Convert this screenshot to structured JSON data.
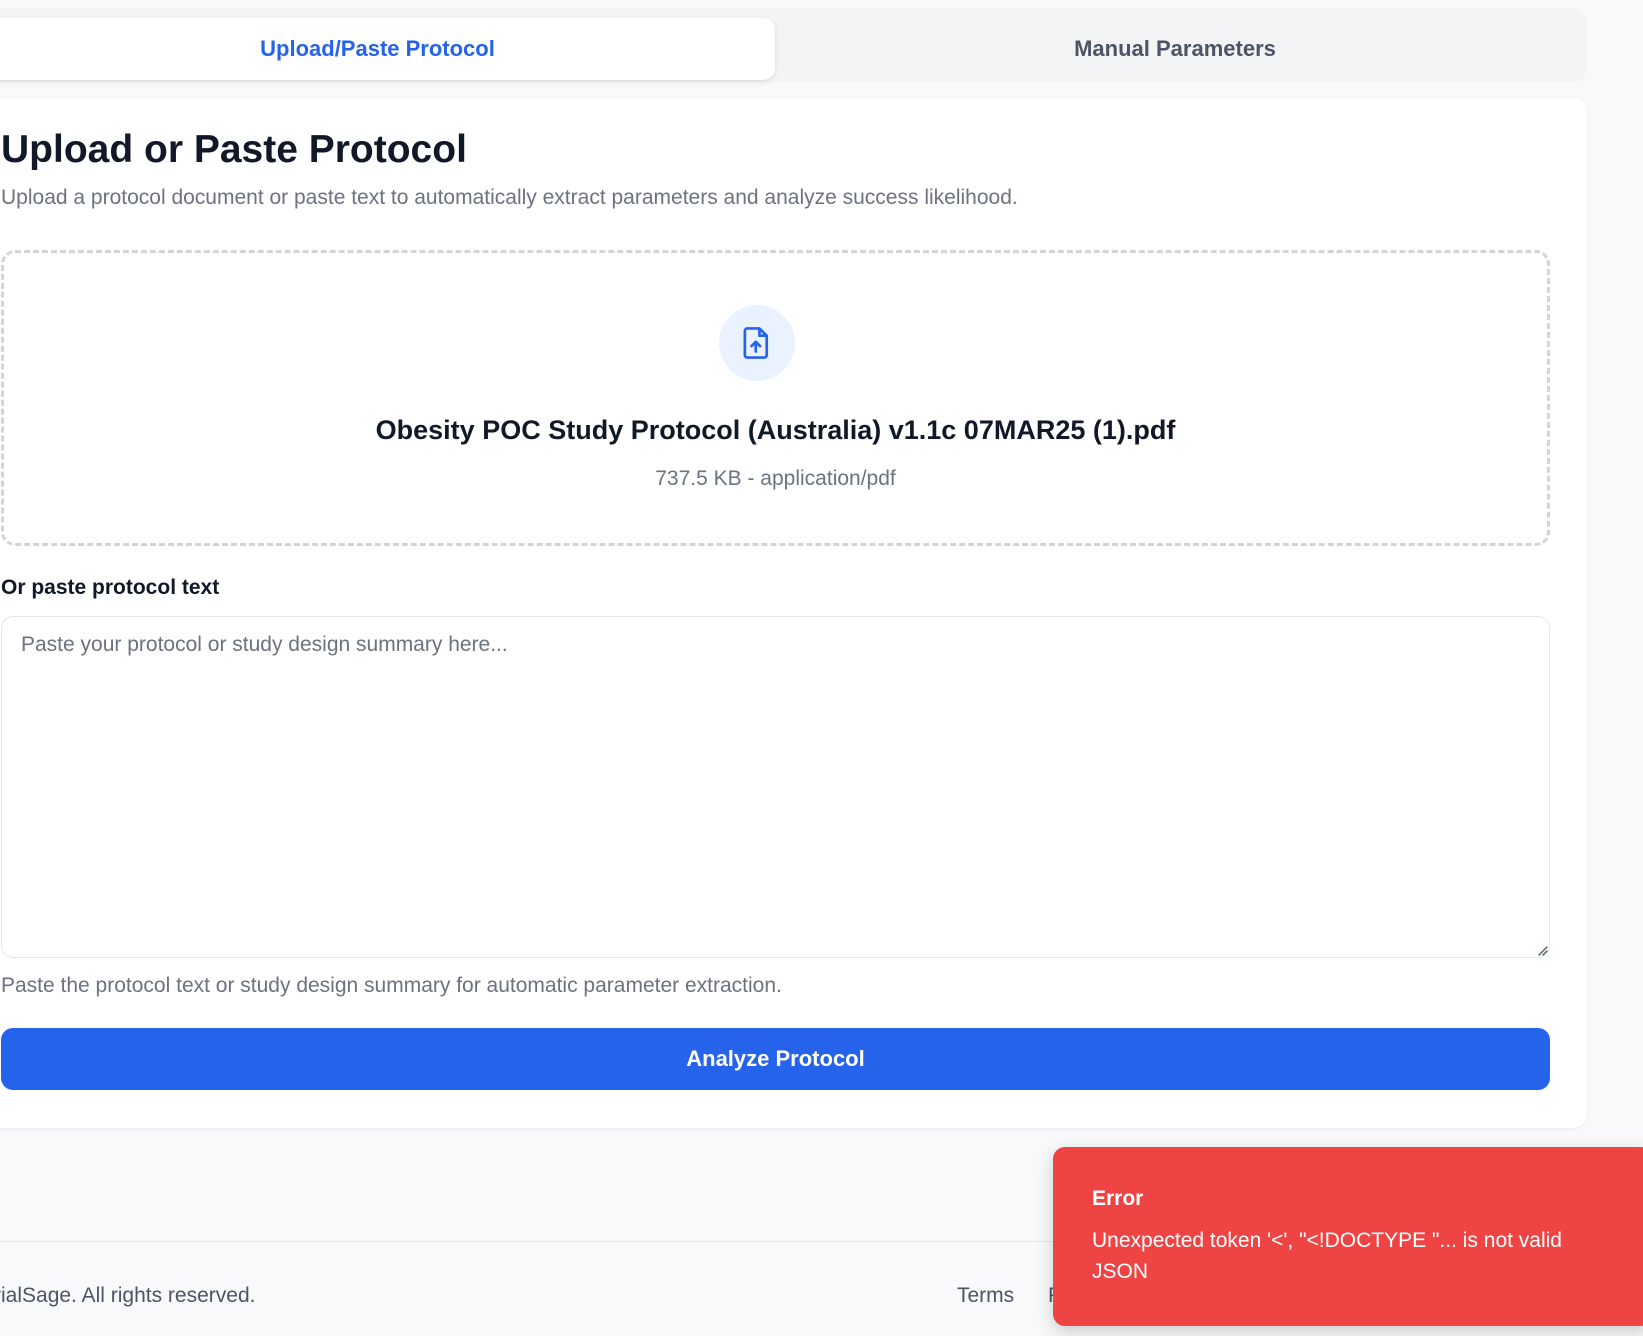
{
  "tabs": {
    "upload_label": "Upload/Paste Protocol",
    "manual_label": "Manual Parameters"
  },
  "main": {
    "title": "Upload or Paste Protocol",
    "subtitle": "Upload a protocol document or paste text to automatically extract parameters and analyze success likelihood."
  },
  "upload": {
    "icon": "file-upload-icon",
    "file_name": "Obesity POC Study Protocol (Australia) v1.1c 07MAR25 (1).pdf",
    "file_meta": "737.5 KB - application/pdf"
  },
  "paste": {
    "label": "Or paste protocol text",
    "placeholder": "Paste your protocol or study design summary here...",
    "value": "",
    "help": "Paste the protocol text or study design summary for automatic parameter extraction."
  },
  "actions": {
    "analyze_label": "Analyze Protocol"
  },
  "footer": {
    "copyright": "rialSage. All rights reserved.",
    "terms_label": "Terms",
    "next_link_fragment": "P"
  },
  "toast": {
    "title": "Error",
    "message": "Unexpected token '<', \"<!DOCTYPE \"... is not valid JSON"
  },
  "colors": {
    "accent": "#2563eb",
    "error": "#ef4444",
    "icon_bg": "#eaf2ff"
  }
}
